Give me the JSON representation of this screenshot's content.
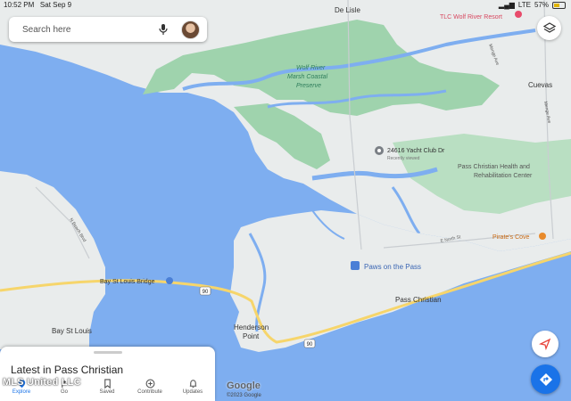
{
  "status_bar": {
    "time": "10:52 PM",
    "date": "Sat Sep 9",
    "network": "LTE",
    "battery": "57%"
  },
  "search": {
    "placeholder": "Search here"
  },
  "map_labels": {
    "de_lisle": "De Lisle",
    "tlc": "TLC Wolf River Resort",
    "wolf_river": [
      "Wolf River",
      "Marsh Coastal",
      "Preserve"
    ],
    "cuevas": "Cuevas",
    "yacht_club": "24616 Yacht Club Dr",
    "recently_viewed": "Recently viewed",
    "health_center": [
      "Pass Christian Health and",
      "Rehabilitation Center"
    ],
    "pirates_cove": "Pirate's Cove",
    "paws": "Paws on the Pass",
    "pass_christian": "Pass Christian",
    "bay_bridge": "Bay St Louis Bridge",
    "bay_st_louis": "Bay St Louis",
    "henderson_point": [
      "Henderson",
      "Point"
    ],
    "highway_90": "90",
    "e_north_st": "E North St",
    "n_beach_blvd": "N Beach Blvd",
    "menge_ave": "Menge Ave"
  },
  "sheet": {
    "title": "Latest in Pass Christian",
    "tabs": [
      {
        "label": "Explore",
        "icon": "explore-icon",
        "active": true
      },
      {
        "label": "Go",
        "icon": "go-icon",
        "active": false
      },
      {
        "label": "Saved",
        "icon": "bookmark-icon",
        "active": false
      },
      {
        "label": "Contribute",
        "icon": "contribute-icon",
        "active": false
      },
      {
        "label": "Updates",
        "icon": "bell-icon",
        "active": false
      }
    ]
  },
  "watermark": "MLS United LLC",
  "google_logo": "Google",
  "copyright": "©2023 Google",
  "colors": {
    "water": "#7eaef0",
    "land": "#e9ecec",
    "green": "#9fd3ad",
    "accent": "#1a73e8",
    "highway": "#f6d56b"
  }
}
